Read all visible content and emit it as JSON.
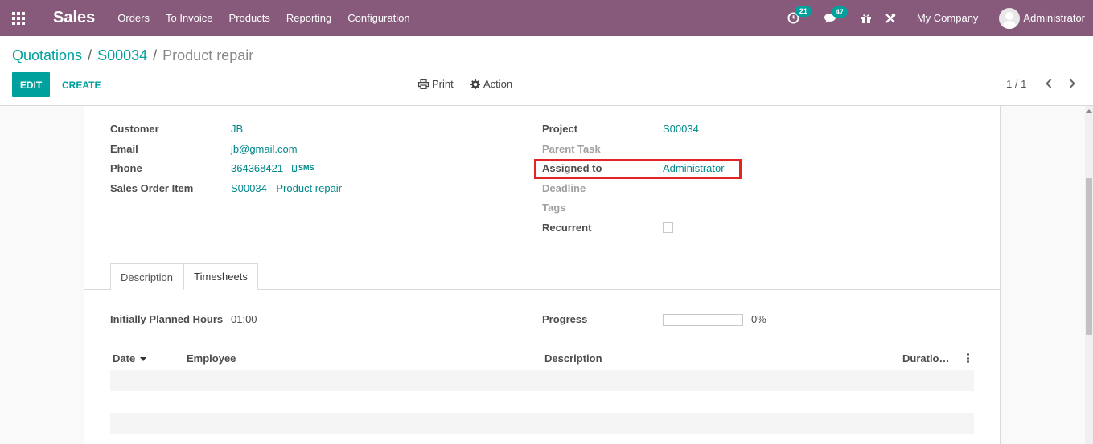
{
  "navbar": {
    "app_title": "Sales",
    "menu": [
      "Orders",
      "To Invoice",
      "Products",
      "Reporting",
      "Configuration"
    ],
    "activity_count": "21",
    "messages_count": "47",
    "company": "My Company",
    "user": "Administrator",
    "background_color": "#875a7b",
    "badge_color": "#00a09d"
  },
  "breadcrumb": {
    "root": "Quotations",
    "parent": "S00034",
    "current": "Product repair",
    "separator": "/"
  },
  "toolbar": {
    "edit_label": "EDIT",
    "create_label": "CREATE",
    "print_label": "Print",
    "action_label": "Action",
    "pager": "1 / 1"
  },
  "form": {
    "left": {
      "customer_label": "Customer",
      "customer_value": "JB",
      "email_label": "Email",
      "email_value": "jb@gmail.com",
      "phone_label": "Phone",
      "phone_value": "364368421",
      "sms_label": "SMS",
      "sales_order_item_label": "Sales Order Item",
      "sales_order_item_value": "S00034 - Product repair"
    },
    "right": {
      "project_label": "Project",
      "project_value": "S00034",
      "parent_task_label": "Parent Task",
      "assigned_to_label": "Assigned to",
      "assigned_to_value": "Administrator",
      "deadline_label": "Deadline",
      "tags_label": "Tags",
      "recurrent_label": "Recurrent",
      "recurrent_checked": false
    }
  },
  "tabs": {
    "description": "Description",
    "timesheets": "Timesheets",
    "active": "Timesheets"
  },
  "timesheets": {
    "planned_hours_label": "Initially Planned Hours",
    "planned_hours_value": "01:00",
    "progress_label": "Progress",
    "progress_value": "0%",
    "progress_fraction": 0,
    "columns": {
      "date": "Date",
      "employee": "Employee",
      "description": "Description",
      "duration": "Duratio…"
    },
    "rows": []
  },
  "annotation": {
    "highlight_color": "#e22424"
  }
}
